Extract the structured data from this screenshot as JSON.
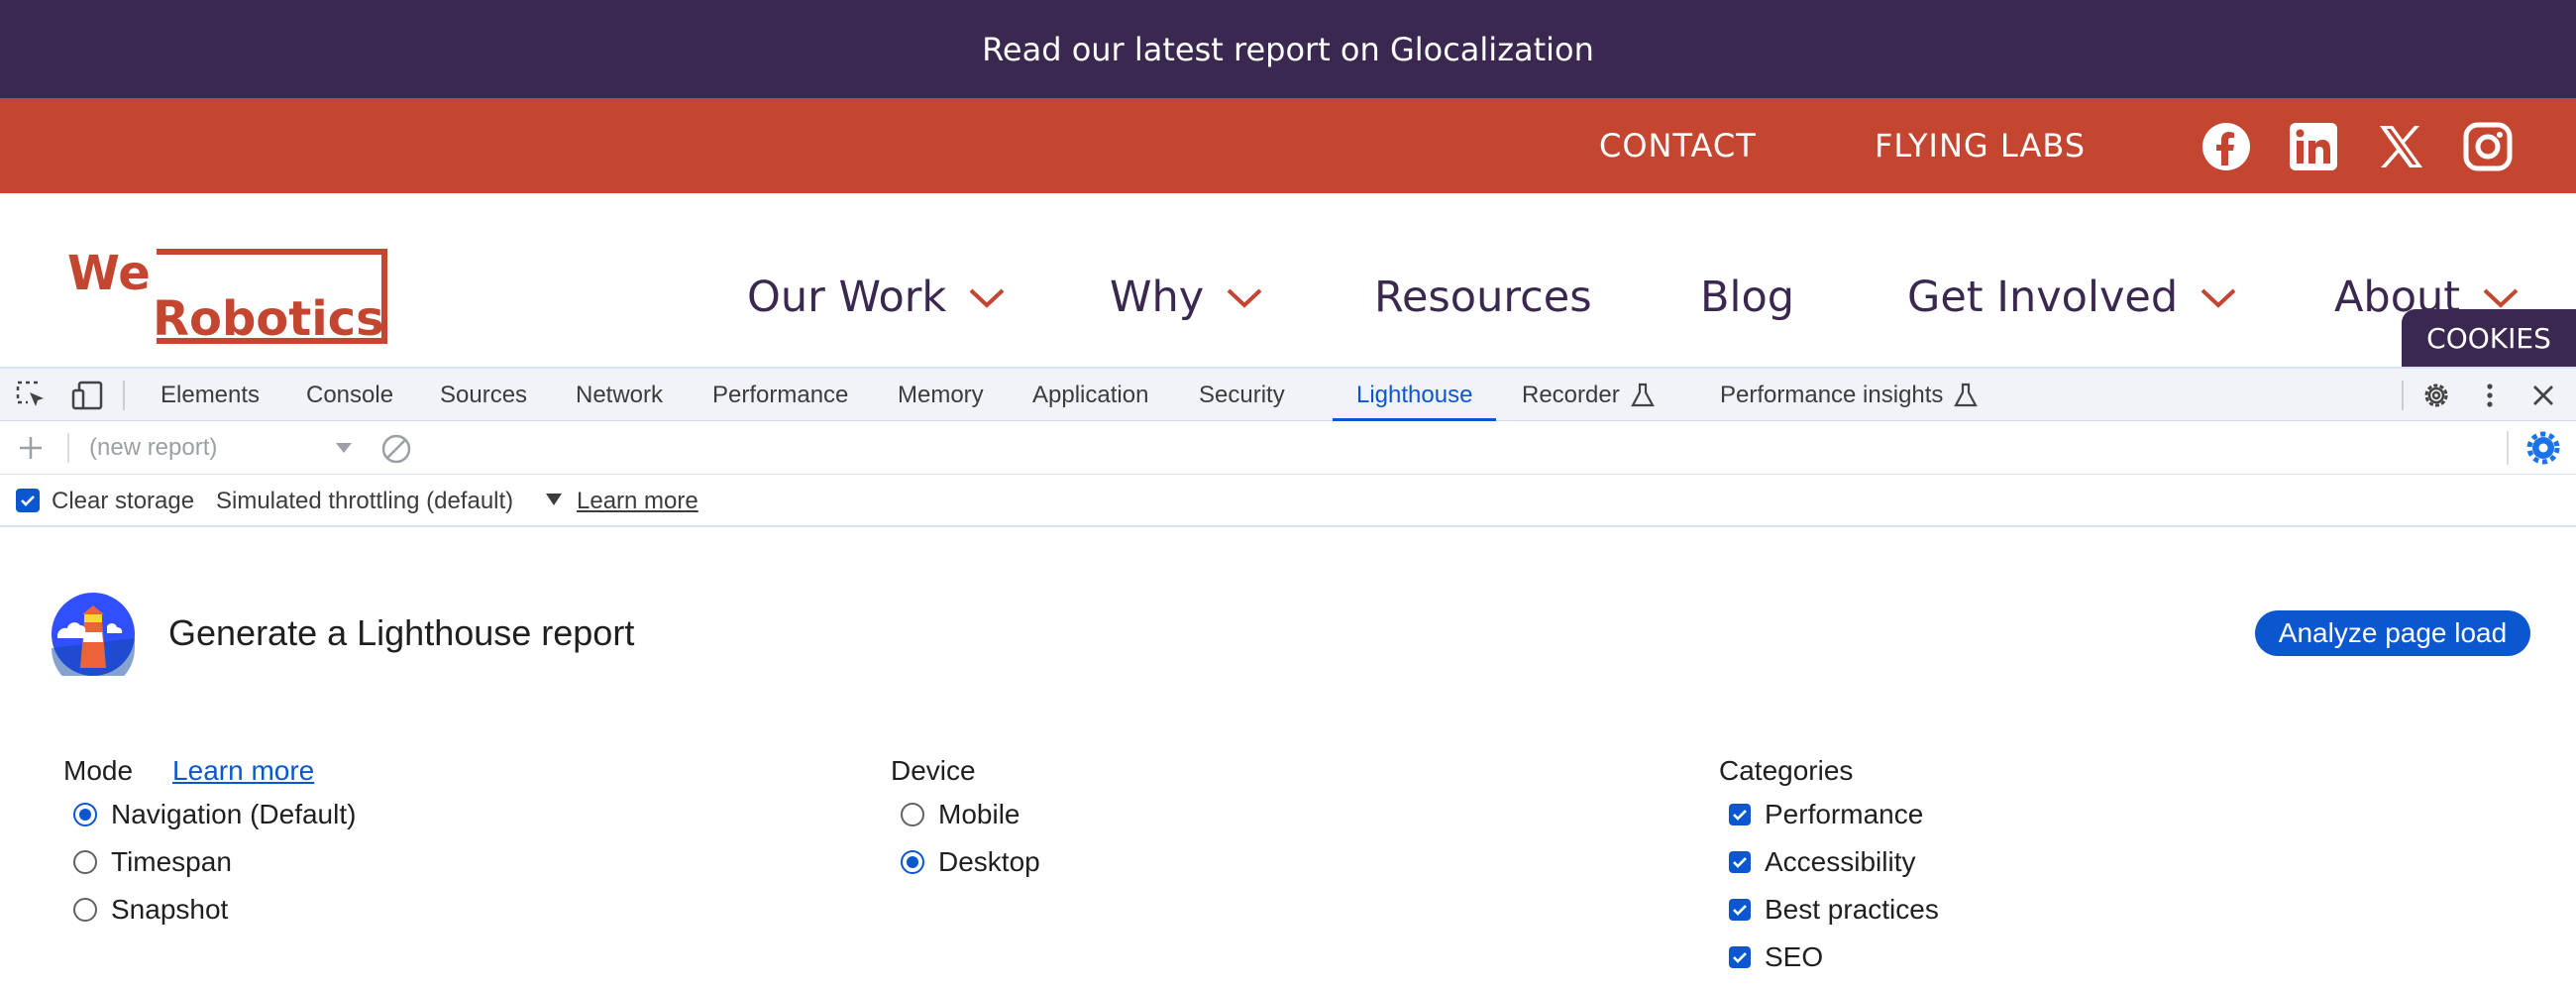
{
  "announcement": {
    "text": "Read our latest report on Glocalization"
  },
  "topbar": {
    "contact": "CONTACT",
    "flying_labs": "FLYING LABS"
  },
  "nav": {
    "logo_text": "WeRobotics",
    "items": [
      {
        "label": "Our Work"
      },
      {
        "label": "Why"
      },
      {
        "label": "Resources"
      },
      {
        "label": "Blog"
      },
      {
        "label": "Get Involved"
      },
      {
        "label": "About"
      }
    ],
    "cookies": "COOKIES"
  },
  "devtools": {
    "tabs": [
      "Elements",
      "Console",
      "Sources",
      "Network",
      "Performance",
      "Memory",
      "Application",
      "Security",
      "Lighthouse",
      "Recorder",
      "Performance insights"
    ],
    "active_tab": "Lighthouse",
    "report_select": "(new report)",
    "clear_storage": "Clear storage",
    "throttling": "Simulated throttling (default)",
    "learn_more": "Learn more"
  },
  "lighthouse": {
    "title": "Generate a Lighthouse report",
    "analyze_button": "Analyze page load",
    "mode": {
      "label": "Mode",
      "learn_more": "Learn more",
      "options": [
        "Navigation (Default)",
        "Timespan",
        "Snapshot"
      ],
      "selected": "Navigation (Default)"
    },
    "device": {
      "label": "Device",
      "options": [
        "Mobile",
        "Desktop"
      ],
      "selected": "Desktop"
    },
    "categories": {
      "label": "Categories",
      "options": [
        "Performance",
        "Accessibility",
        "Best practices",
        "SEO"
      ]
    }
  },
  "colors": {
    "announce_bg": "#3a2850",
    "orange": "#c44630",
    "devtools_blue": "#0b57d0"
  }
}
